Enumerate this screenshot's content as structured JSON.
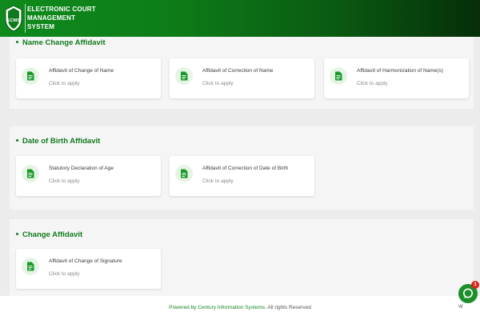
{
  "header": {
    "title_lines": [
      "ELECTRONIC COURT",
      "MANAGEMENT",
      "SYSTEM"
    ],
    "logo_text": "ECMS"
  },
  "sections": [
    {
      "title": "Name Change Affidavit",
      "cards": [
        {
          "title": "Affidavit of Change of Name",
          "subtitle": "Click to apply",
          "icon": "document-icon"
        },
        {
          "title": "Affidavit of Correction of Name",
          "subtitle": "Click to apply",
          "icon": "document-icon"
        },
        {
          "title": "Affidavit of Harmonization of Name(s)",
          "subtitle": "Click to apply",
          "icon": "document-icon"
        }
      ]
    },
    {
      "title": "Date of Birth Affidavit",
      "cards": [
        {
          "title": "Statutory Declaration of Age",
          "subtitle": "Click to apply",
          "icon": "document-icon"
        },
        {
          "title": "Affidavit of Correction of Date of Birth",
          "subtitle": "Click to apply",
          "icon": "document-icon"
        }
      ]
    },
    {
      "title": "Change Affidavit",
      "cards": [
        {
          "title": "Affidavit of Change of Signature",
          "subtitle": "Click to apply",
          "icon": "document-icon"
        }
      ]
    }
  ],
  "footer": {
    "powered_text": "Powered by Century Information Systems.",
    "rights_text": "All rights Reserved"
  },
  "chat": {
    "badge_count": "1",
    "label": "W"
  },
  "colors": {
    "brand_green": "#0f7a1b",
    "header_dark": "#062e09",
    "icon_bg": "#e6f4e6",
    "badge_red": "#d7261e"
  }
}
